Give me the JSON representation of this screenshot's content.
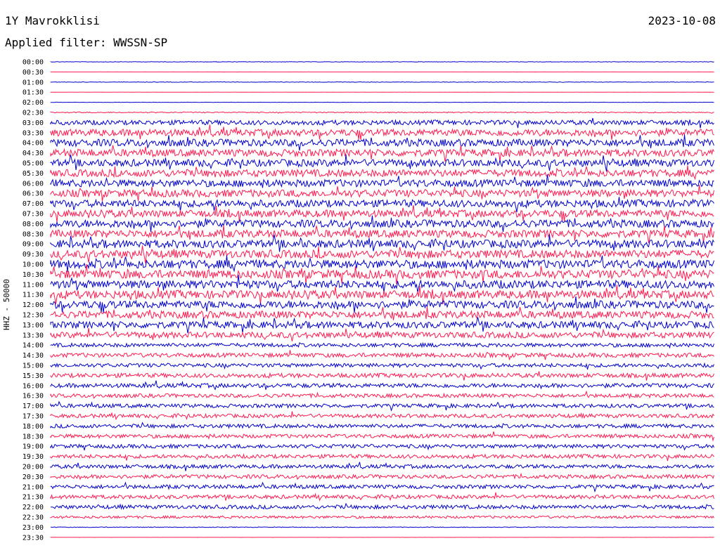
{
  "header": {
    "station": "1Y Mavrokklisi",
    "date": "2023-10-08",
    "filter": "Applied filter: WWSSN-SP"
  },
  "chart_data": {
    "type": "line",
    "title": "1Y Mavrokklisi",
    "ylabel": "HHZ - 50000",
    "colors": [
      "#0000cc",
      "#ff1a4f"
    ],
    "rows": [
      "00:00",
      "00:30",
      "01:00",
      "01:30",
      "02:00",
      "02:30",
      "03:00",
      "03:30",
      "04:00",
      "04:30",
      "05:00",
      "05:30",
      "06:00",
      "06:30",
      "07:00",
      "07:30",
      "08:00",
      "08:30",
      "09:00",
      "09:30",
      "10:00",
      "10:30",
      "11:00",
      "11:30",
      "12:00",
      "12:30",
      "13:00",
      "13:30",
      "14:00",
      "14:30",
      "15:00",
      "15:30",
      "16:00",
      "16:30",
      "17:00",
      "17:30",
      "18:00",
      "18:30",
      "19:00",
      "19:30",
      "20:00",
      "20:30",
      "21:00",
      "21:30",
      "22:00",
      "22:30",
      "23:00",
      "23:30"
    ],
    "activity": [
      0.05,
      0.01,
      0.06,
      0.02,
      0.03,
      0.12,
      0.55,
      0.8,
      0.85,
      0.85,
      0.85,
      0.85,
      0.85,
      0.85,
      0.85,
      0.85,
      0.9,
      0.9,
      0.95,
      0.95,
      1.0,
      1.0,
      0.95,
      0.95,
      0.9,
      0.85,
      0.8,
      0.7,
      0.45,
      0.5,
      0.45,
      0.5,
      0.5,
      0.45,
      0.45,
      0.45,
      0.45,
      0.45,
      0.45,
      0.45,
      0.45,
      0.45,
      0.45,
      0.45,
      0.45,
      0.3,
      0.08,
      0.02
    ],
    "grid": false
  }
}
